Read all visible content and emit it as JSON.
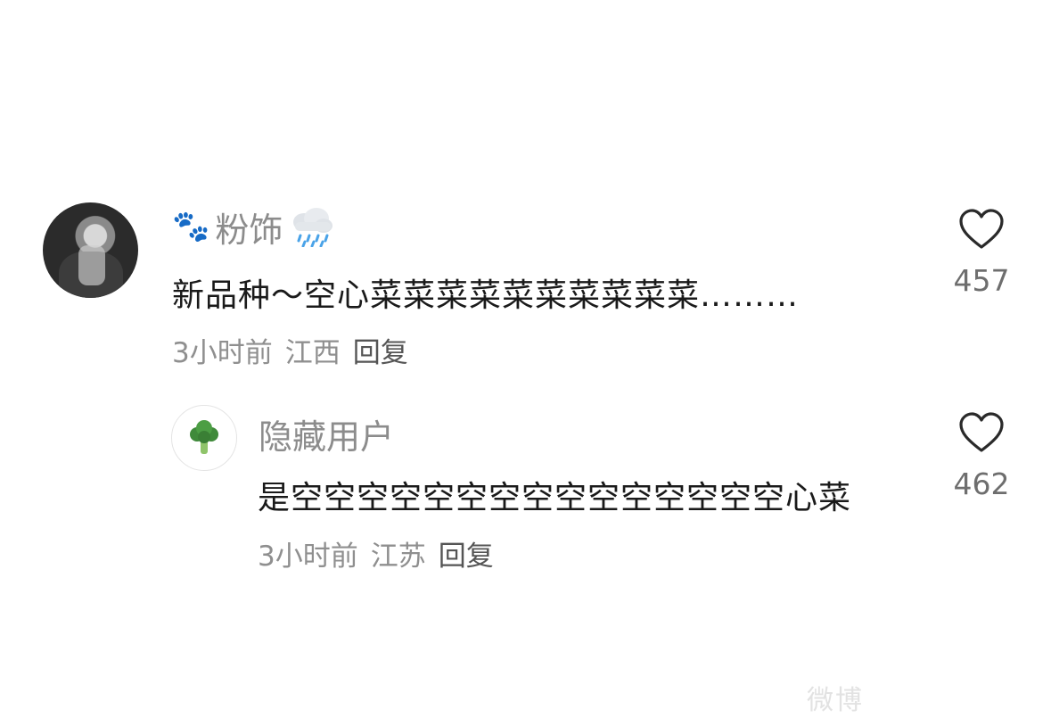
{
  "comment": {
    "username": "粉饰",
    "text": "新品种～空心菜菜菜菜菜菜菜菜菜菜………",
    "time": "3小时前",
    "location": "江西",
    "reply_label": "回复",
    "likes": "457"
  },
  "reply": {
    "username": "隐藏用户",
    "text": "是空空空空空空空空空空空空空空空心菜",
    "time": "3小时前",
    "location": "江苏",
    "reply_label": "回复",
    "likes": "462"
  },
  "watermark": "微博"
}
